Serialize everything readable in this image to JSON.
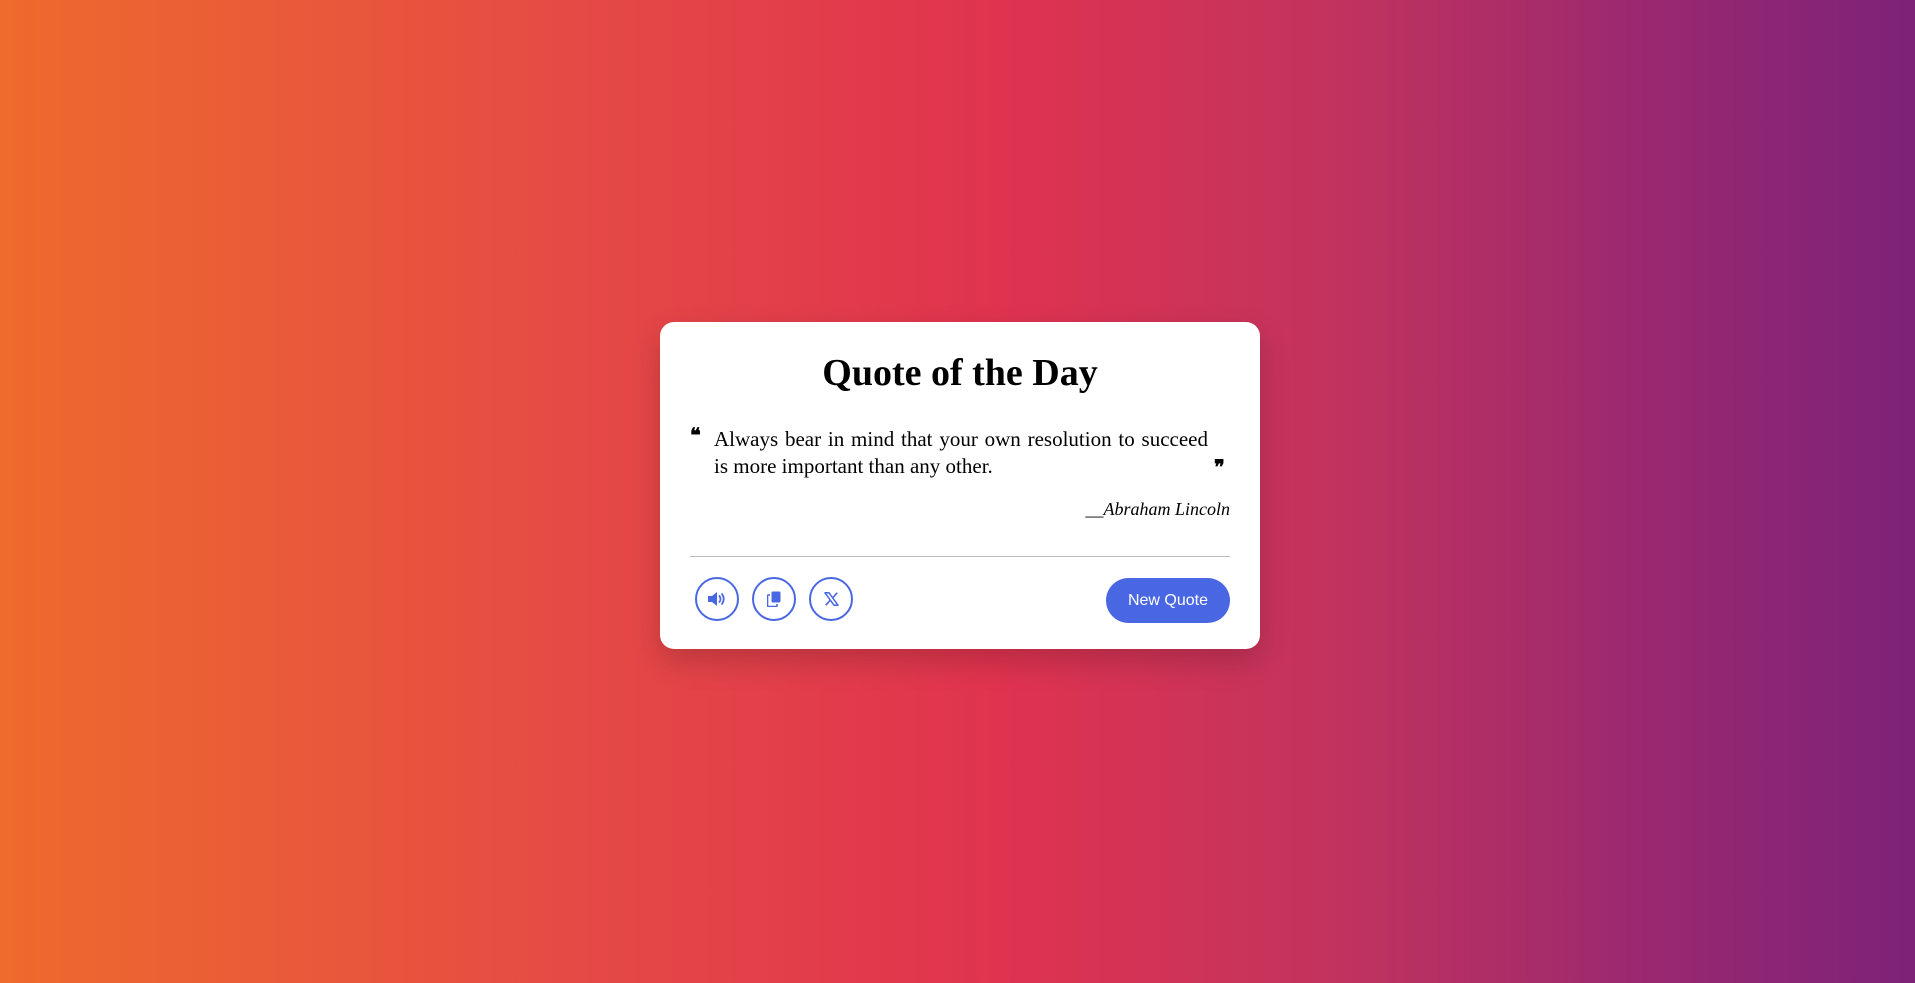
{
  "card": {
    "title": "Quote of the Day",
    "quote_open_mark": "❝",
    "quote_text": "Always bear in mind that your own resolution to succeed is more important than any other.",
    "quote_close_mark": "❞",
    "author": "__Abraham Lincoln"
  },
  "actions": {
    "sound_icon": "volume-icon",
    "copy_icon": "copy-icon",
    "share_icon": "x-twitter-icon",
    "new_quote_label": "New Quote"
  },
  "colors": {
    "accent": "#4a67e3",
    "background_gradient": [
      "#ee6a2d",
      "#e0334f",
      "#7d2278"
    ],
    "card": "#ffffff"
  }
}
